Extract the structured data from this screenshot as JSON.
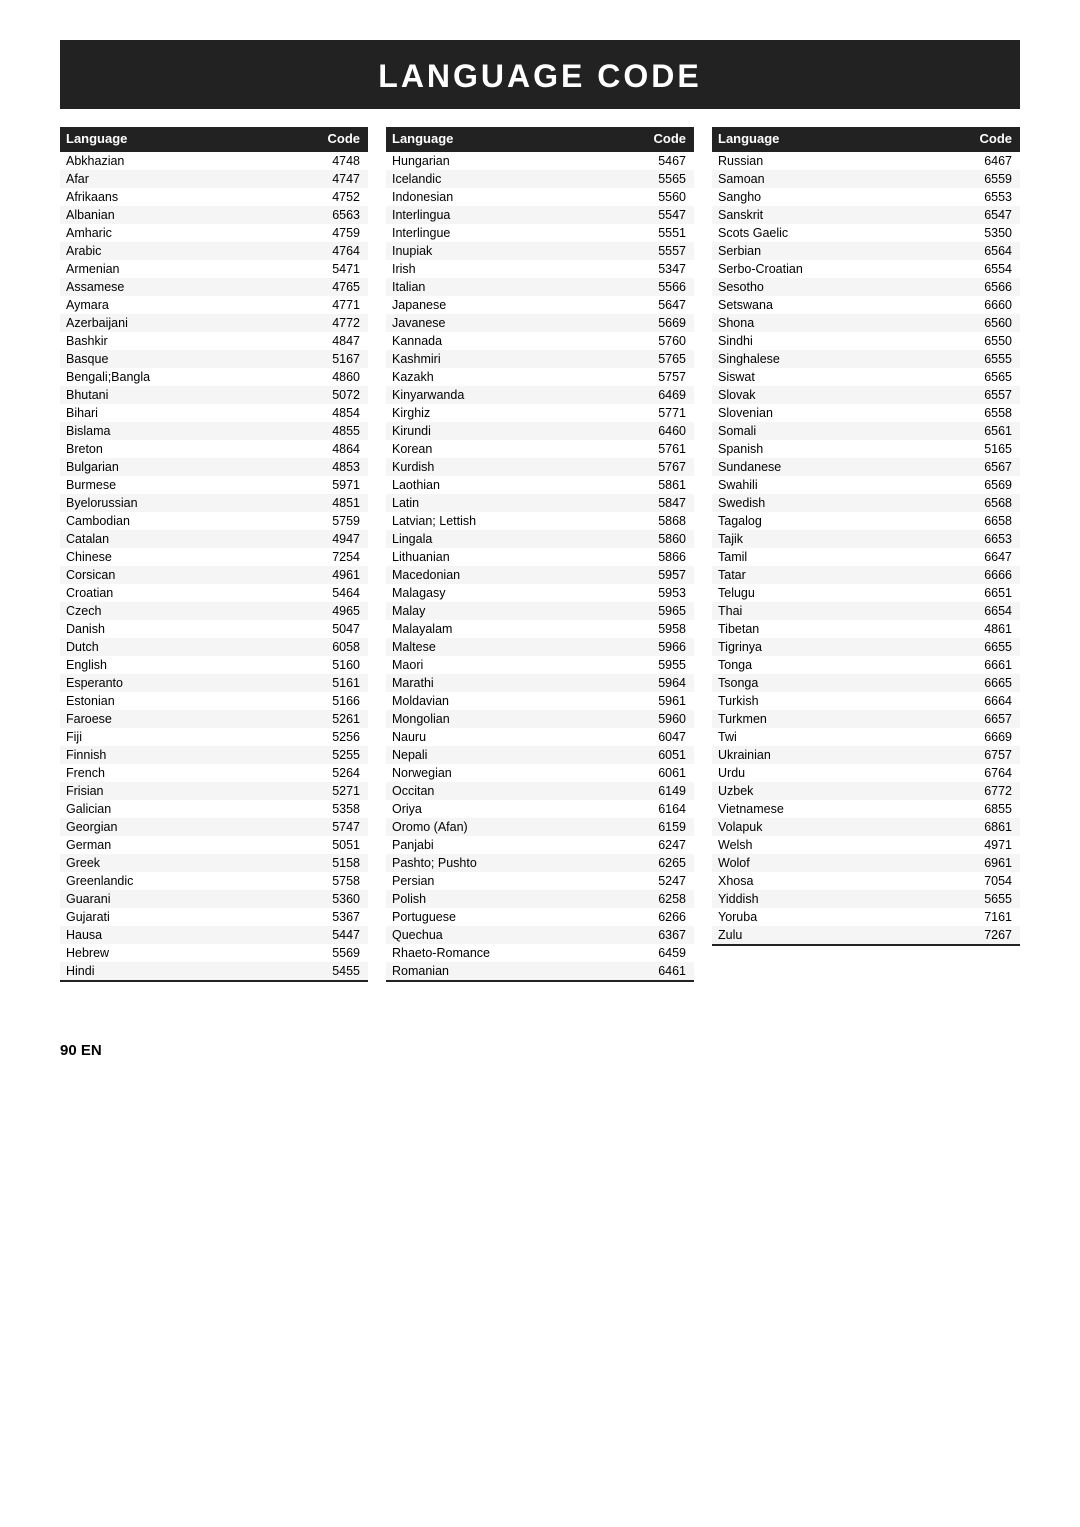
{
  "title": "LANGUAGE CODE",
  "col1_header": {
    "lang": "Language",
    "code": "Code"
  },
  "col2_header": {
    "lang": "Language",
    "code": "Code"
  },
  "col3_header": {
    "lang": "Language",
    "code": "Code"
  },
  "col1": [
    {
      "lang": "Abkhazian",
      "code": "4748"
    },
    {
      "lang": "Afar",
      "code": "4747"
    },
    {
      "lang": "Afrikaans",
      "code": "4752"
    },
    {
      "lang": "Albanian",
      "code": "6563"
    },
    {
      "lang": "Amharic",
      "code": "4759"
    },
    {
      "lang": "Arabic",
      "code": "4764"
    },
    {
      "lang": "Armenian",
      "code": "5471"
    },
    {
      "lang": "Assamese",
      "code": "4765"
    },
    {
      "lang": "Aymara",
      "code": "4771"
    },
    {
      "lang": "Azerbaijani",
      "code": "4772"
    },
    {
      "lang": "Bashkir",
      "code": "4847"
    },
    {
      "lang": "Basque",
      "code": "5167"
    },
    {
      "lang": "Bengali;Bangla",
      "code": "4860"
    },
    {
      "lang": "Bhutani",
      "code": "5072"
    },
    {
      "lang": "Bihari",
      "code": "4854"
    },
    {
      "lang": "Bislama",
      "code": "4855"
    },
    {
      "lang": "Breton",
      "code": "4864"
    },
    {
      "lang": "Bulgarian",
      "code": "4853"
    },
    {
      "lang": "Burmese",
      "code": "5971"
    },
    {
      "lang": "Byelorussian",
      "code": "4851"
    },
    {
      "lang": "Cambodian",
      "code": "5759"
    },
    {
      "lang": "Catalan",
      "code": "4947"
    },
    {
      "lang": "Chinese",
      "code": "7254"
    },
    {
      "lang": "Corsican",
      "code": "4961"
    },
    {
      "lang": "Croatian",
      "code": "5464"
    },
    {
      "lang": "Czech",
      "code": "4965"
    },
    {
      "lang": "Danish",
      "code": "5047"
    },
    {
      "lang": "Dutch",
      "code": "6058"
    },
    {
      "lang": "English",
      "code": "5160"
    },
    {
      "lang": "Esperanto",
      "code": "5161"
    },
    {
      "lang": "Estonian",
      "code": "5166"
    },
    {
      "lang": "Faroese",
      "code": "5261"
    },
    {
      "lang": "Fiji",
      "code": "5256"
    },
    {
      "lang": "Finnish",
      "code": "5255"
    },
    {
      "lang": "French",
      "code": "5264"
    },
    {
      "lang": "Frisian",
      "code": "5271"
    },
    {
      "lang": "Galician",
      "code": "5358"
    },
    {
      "lang": "Georgian",
      "code": "5747"
    },
    {
      "lang": "German",
      "code": "5051"
    },
    {
      "lang": "Greek",
      "code": "5158"
    },
    {
      "lang": "Greenlandic",
      "code": "5758"
    },
    {
      "lang": "Guarani",
      "code": "5360"
    },
    {
      "lang": "Gujarati",
      "code": "5367"
    },
    {
      "lang": "Hausa",
      "code": "5447"
    },
    {
      "lang": "Hebrew",
      "code": "5569"
    },
    {
      "lang": "Hindi",
      "code": "5455"
    }
  ],
  "col2": [
    {
      "lang": "Hungarian",
      "code": "5467"
    },
    {
      "lang": "Icelandic",
      "code": "5565"
    },
    {
      "lang": "Indonesian",
      "code": "5560"
    },
    {
      "lang": "Interlingua",
      "code": "5547"
    },
    {
      "lang": "Interlingue",
      "code": "5551"
    },
    {
      "lang": "Inupiak",
      "code": "5557"
    },
    {
      "lang": "Irish",
      "code": "5347"
    },
    {
      "lang": "Italian",
      "code": "5566"
    },
    {
      "lang": "Japanese",
      "code": "5647"
    },
    {
      "lang": "Javanese",
      "code": "5669"
    },
    {
      "lang": "Kannada",
      "code": "5760"
    },
    {
      "lang": "Kashmiri",
      "code": "5765"
    },
    {
      "lang": "Kazakh",
      "code": "5757"
    },
    {
      "lang": "Kinyarwanda",
      "code": "6469"
    },
    {
      "lang": "Kirghiz",
      "code": "5771"
    },
    {
      "lang": "Kirundi",
      "code": "6460"
    },
    {
      "lang": "Korean",
      "code": "5761"
    },
    {
      "lang": "Kurdish",
      "code": "5767"
    },
    {
      "lang": "Laothian",
      "code": "5861"
    },
    {
      "lang": "Latin",
      "code": "5847"
    },
    {
      "lang": "Latvian; Lettish",
      "code": "5868"
    },
    {
      "lang": "Lingala",
      "code": "5860"
    },
    {
      "lang": "Lithuanian",
      "code": "5866"
    },
    {
      "lang": "Macedonian",
      "code": "5957"
    },
    {
      "lang": "Malagasy",
      "code": "5953"
    },
    {
      "lang": "Malay",
      "code": "5965"
    },
    {
      "lang": "Malayalam",
      "code": "5958"
    },
    {
      "lang": "Maltese",
      "code": "5966"
    },
    {
      "lang": "Maori",
      "code": "5955"
    },
    {
      "lang": "Marathi",
      "code": "5964"
    },
    {
      "lang": "Moldavian",
      "code": "5961"
    },
    {
      "lang": "Mongolian",
      "code": "5960"
    },
    {
      "lang": "Nauru",
      "code": "6047"
    },
    {
      "lang": "Nepali",
      "code": "6051"
    },
    {
      "lang": "Norwegian",
      "code": "6061"
    },
    {
      "lang": "Occitan",
      "code": "6149"
    },
    {
      "lang": "Oriya",
      "code": "6164"
    },
    {
      "lang": "Oromo (Afan)",
      "code": "6159"
    },
    {
      "lang": "Panjabi",
      "code": "6247"
    },
    {
      "lang": "Pashto; Pushto",
      "code": "6265"
    },
    {
      "lang": "Persian",
      "code": "5247"
    },
    {
      "lang": "Polish",
      "code": "6258"
    },
    {
      "lang": "Portuguese",
      "code": "6266"
    },
    {
      "lang": "Quechua",
      "code": "6367"
    },
    {
      "lang": "Rhaeto-Romance",
      "code": "6459"
    },
    {
      "lang": "Romanian",
      "code": "6461"
    }
  ],
  "col3": [
    {
      "lang": "Russian",
      "code": "6467"
    },
    {
      "lang": "Samoan",
      "code": "6559"
    },
    {
      "lang": "Sangho",
      "code": "6553"
    },
    {
      "lang": "Sanskrit",
      "code": "6547"
    },
    {
      "lang": "Scots Gaelic",
      "code": "5350"
    },
    {
      "lang": "Serbian",
      "code": "6564"
    },
    {
      "lang": "Serbo-Croatian",
      "code": "6554"
    },
    {
      "lang": "Sesotho",
      "code": "6566"
    },
    {
      "lang": "Setswana",
      "code": "6660"
    },
    {
      "lang": "Shona",
      "code": "6560"
    },
    {
      "lang": "Sindhi",
      "code": "6550"
    },
    {
      "lang": "Singhalese",
      "code": "6555"
    },
    {
      "lang": "Siswat",
      "code": "6565"
    },
    {
      "lang": "Slovak",
      "code": "6557"
    },
    {
      "lang": "Slovenian",
      "code": "6558"
    },
    {
      "lang": "Somali",
      "code": "6561"
    },
    {
      "lang": "Spanish",
      "code": "5165"
    },
    {
      "lang": "Sundanese",
      "code": "6567"
    },
    {
      "lang": "Swahili",
      "code": "6569"
    },
    {
      "lang": "Swedish",
      "code": "6568"
    },
    {
      "lang": "Tagalog",
      "code": "6658"
    },
    {
      "lang": "Tajik",
      "code": "6653"
    },
    {
      "lang": "Tamil",
      "code": "6647"
    },
    {
      "lang": "Tatar",
      "code": "6666"
    },
    {
      "lang": "Telugu",
      "code": "6651"
    },
    {
      "lang": "Thai",
      "code": "6654"
    },
    {
      "lang": "Tibetan",
      "code": "4861"
    },
    {
      "lang": "Tigrinya",
      "code": "6655"
    },
    {
      "lang": "Tonga",
      "code": "6661"
    },
    {
      "lang": "Tsonga",
      "code": "6665"
    },
    {
      "lang": "Turkish",
      "code": "6664"
    },
    {
      "lang": "Turkmen",
      "code": "6657"
    },
    {
      "lang": "Twi",
      "code": "6669"
    },
    {
      "lang": "Ukrainian",
      "code": "6757"
    },
    {
      "lang": "Urdu",
      "code": "6764"
    },
    {
      "lang": "Uzbek",
      "code": "6772"
    },
    {
      "lang": "Vietnamese",
      "code": "6855"
    },
    {
      "lang": "Volapuk",
      "code": "6861"
    },
    {
      "lang": "Welsh",
      "code": "4971"
    },
    {
      "lang": "Wolof",
      "code": "6961"
    },
    {
      "lang": "Xhosa",
      "code": "7054"
    },
    {
      "lang": "Yiddish",
      "code": "5655"
    },
    {
      "lang": "Yoruba",
      "code": "7161"
    },
    {
      "lang": "Zulu",
      "code": "7267"
    }
  ],
  "footer": "90  EN"
}
